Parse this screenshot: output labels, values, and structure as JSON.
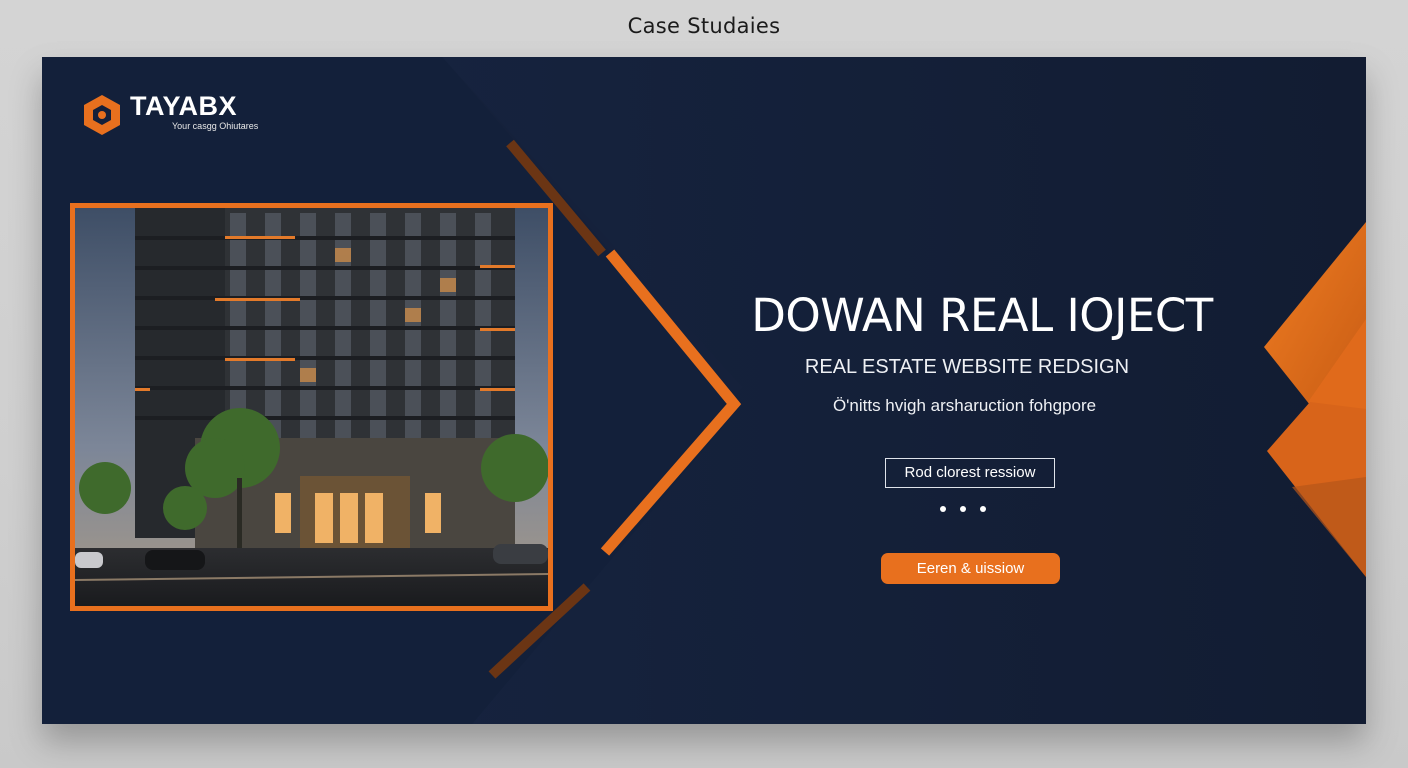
{
  "page": {
    "heading": "Case Studaies"
  },
  "brand": {
    "name": "TAYABX",
    "tagline": "Your casgg Ohiutares",
    "logo_icon": "hexagon-icon",
    "accent_color": "#e8701e",
    "background_color": "#14203a"
  },
  "project": {
    "title": "DOWAN REAL IOJECT",
    "subtitle": "REAL ESTATE WEBSITE REDSIGN",
    "description": "Ö'nitts hvigh arsharuction fohgpore",
    "secondary_button": "Rod clorest ressiow",
    "primary_button": "Eeren & uissiow",
    "carousel": {
      "total": 3,
      "active": 1
    },
    "image": {
      "subject": "residential-tower-photo"
    }
  }
}
